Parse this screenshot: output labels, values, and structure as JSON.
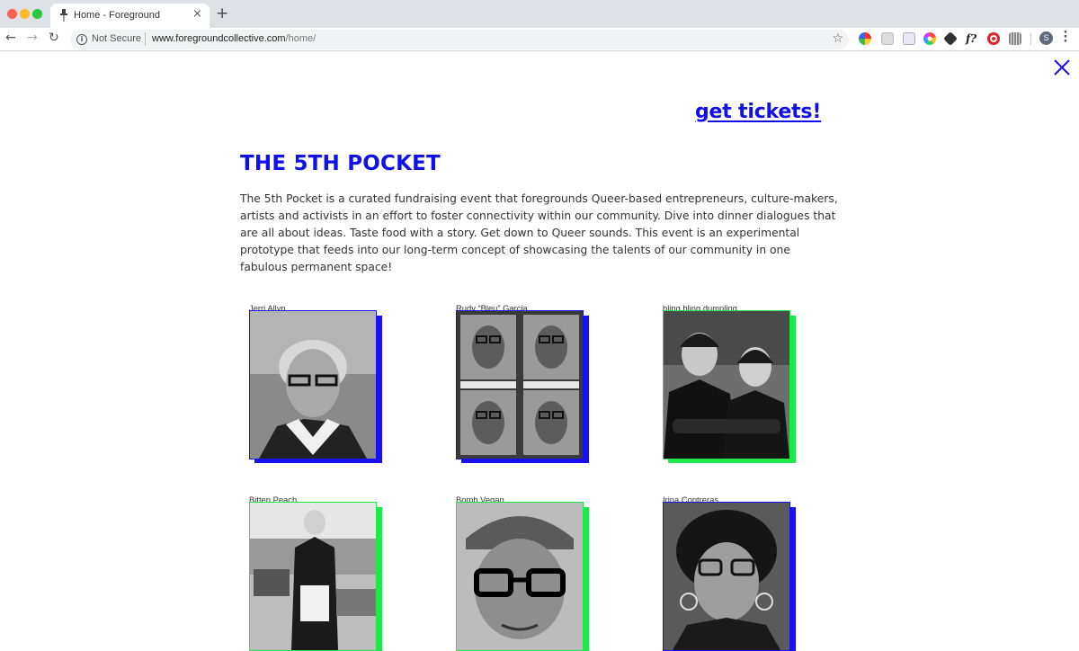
{
  "browser": {
    "tab_title": "Home - Foreground",
    "tab_close": "×",
    "new_tab": "+",
    "nav": {
      "back": "←",
      "forward": "→",
      "reload": "↻"
    },
    "security_label": "Not Secure",
    "url_domain": "www.foregroundcollective.com",
    "url_path": "/home/",
    "profile_initial": "S",
    "extensions": [
      "color-wheel-icon",
      "document-icon",
      "image-icon",
      "flower-icon",
      "cube-icon",
      "font-icon",
      "block-icon",
      "barcode-icon"
    ]
  },
  "page": {
    "tickets_link": "get tickets!",
    "title": "THE 5TH POCKET",
    "intro": "The 5th Pocket is a curated fundraising event that foregrounds Queer-based entrepreneurs, culture-makers, artists and activists in an effort to foster connectivity within our community. Dive into dinner dialogues that are all about ideas. Taste food with a story. Get down to Queer sounds. This event is an experimental prototype that feeds into our long-term concept of showcasing the talents of our community in one fabulous permanent space!"
  },
  "people": [
    {
      "name": "Jerri Allyn",
      "accent": "#1a10f0"
    },
    {
      "name": "Rudy “Bleu” Garcia",
      "accent": "#1a10f0"
    },
    {
      "name": "bling bling dumpling",
      "accent": "#1ee84a"
    },
    {
      "name": "Bitten Peach",
      "accent": "#1ee84a"
    },
    {
      "name": "Bomb Vegan",
      "accent": "#1ee84a"
    },
    {
      "name": "Irina Contreras",
      "accent": "#1a10f0"
    }
  ],
  "colors": {
    "brand_blue": "#1010e8",
    "accent_green": "#1ee84a"
  }
}
